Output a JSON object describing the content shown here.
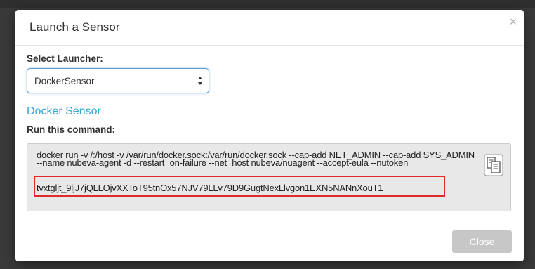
{
  "dialog": {
    "title": "Launch a Sensor",
    "close_icon": "×"
  },
  "launcher": {
    "label": "Select Launcher:",
    "selected": "DockerSensor"
  },
  "sensor": {
    "link_title": "Docker Sensor",
    "run_label": "Run this command:",
    "command_text": "docker run -v /:/host -v /var/run/docker.sock:/var/run/docker.sock --cap-add NET_ADMIN --cap-add SYS_ADMIN --name nubeva-agent -d --restart=on-failure --net=host nubeva/nuagent --accept-eula --nutoken",
    "token": "tvxtgljt_9ljJ7jQLLOjvXXToT95tnOx57NJV79LLv79D9GugtNexLlvgon1EXN5NANnXouT1",
    "copy_icon": "copy-clipboard-icon"
  },
  "footer": {
    "close_label": "Close"
  },
  "colors": {
    "link": "#35a7d8",
    "highlight": "#e32a2a",
    "select_focus": "#5b9dd9",
    "close_button": "#c7c7c7"
  }
}
